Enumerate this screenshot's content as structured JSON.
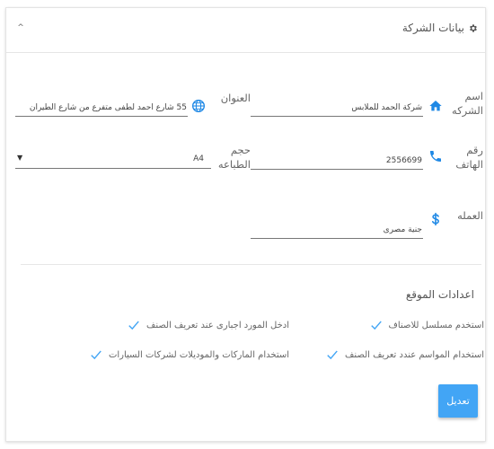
{
  "header": {
    "title": "بيانات الشركة",
    "title_icon": "gear-icon",
    "collapse_icon": "chevron-up-icon",
    "collapse_glyph": "^"
  },
  "form": {
    "company_name": {
      "label": "اسم الشركه",
      "icon": "home-icon",
      "value": "شركة الحمد للملابس"
    },
    "address": {
      "label": "العنوان",
      "icon": "globe-icon",
      "value": "55 شارع احمد لطفى متفرع من شارع الطيران"
    },
    "phone": {
      "label": "رقم الهاتف",
      "icon": "phone-icon",
      "value": "2556699"
    },
    "print_size": {
      "label": "حجم الطباعه",
      "value": "A4",
      "arrow": "▼"
    },
    "currency": {
      "label": "العمله",
      "icon": "dollar-icon",
      "value": "جنية مصرى"
    }
  },
  "site_settings": {
    "title": "اعدادات الموقع",
    "options": [
      {
        "label": "استخدم مسلسل للاصناف",
        "checked": true
      },
      {
        "label": "استخدام المواسم عندد تعريف الصنف",
        "checked": true
      },
      {
        "label": "ادخل المورد اجبارى عند تعريف الصنف",
        "checked": true
      },
      {
        "label": "استخدام الماركات والموديلات لشركات السيارات",
        "checked": true
      }
    ]
  },
  "actions": {
    "edit_label": "تعديل"
  },
  "colors": {
    "accent": "#42a5f5",
    "icon_blue": "#1e88e5"
  }
}
